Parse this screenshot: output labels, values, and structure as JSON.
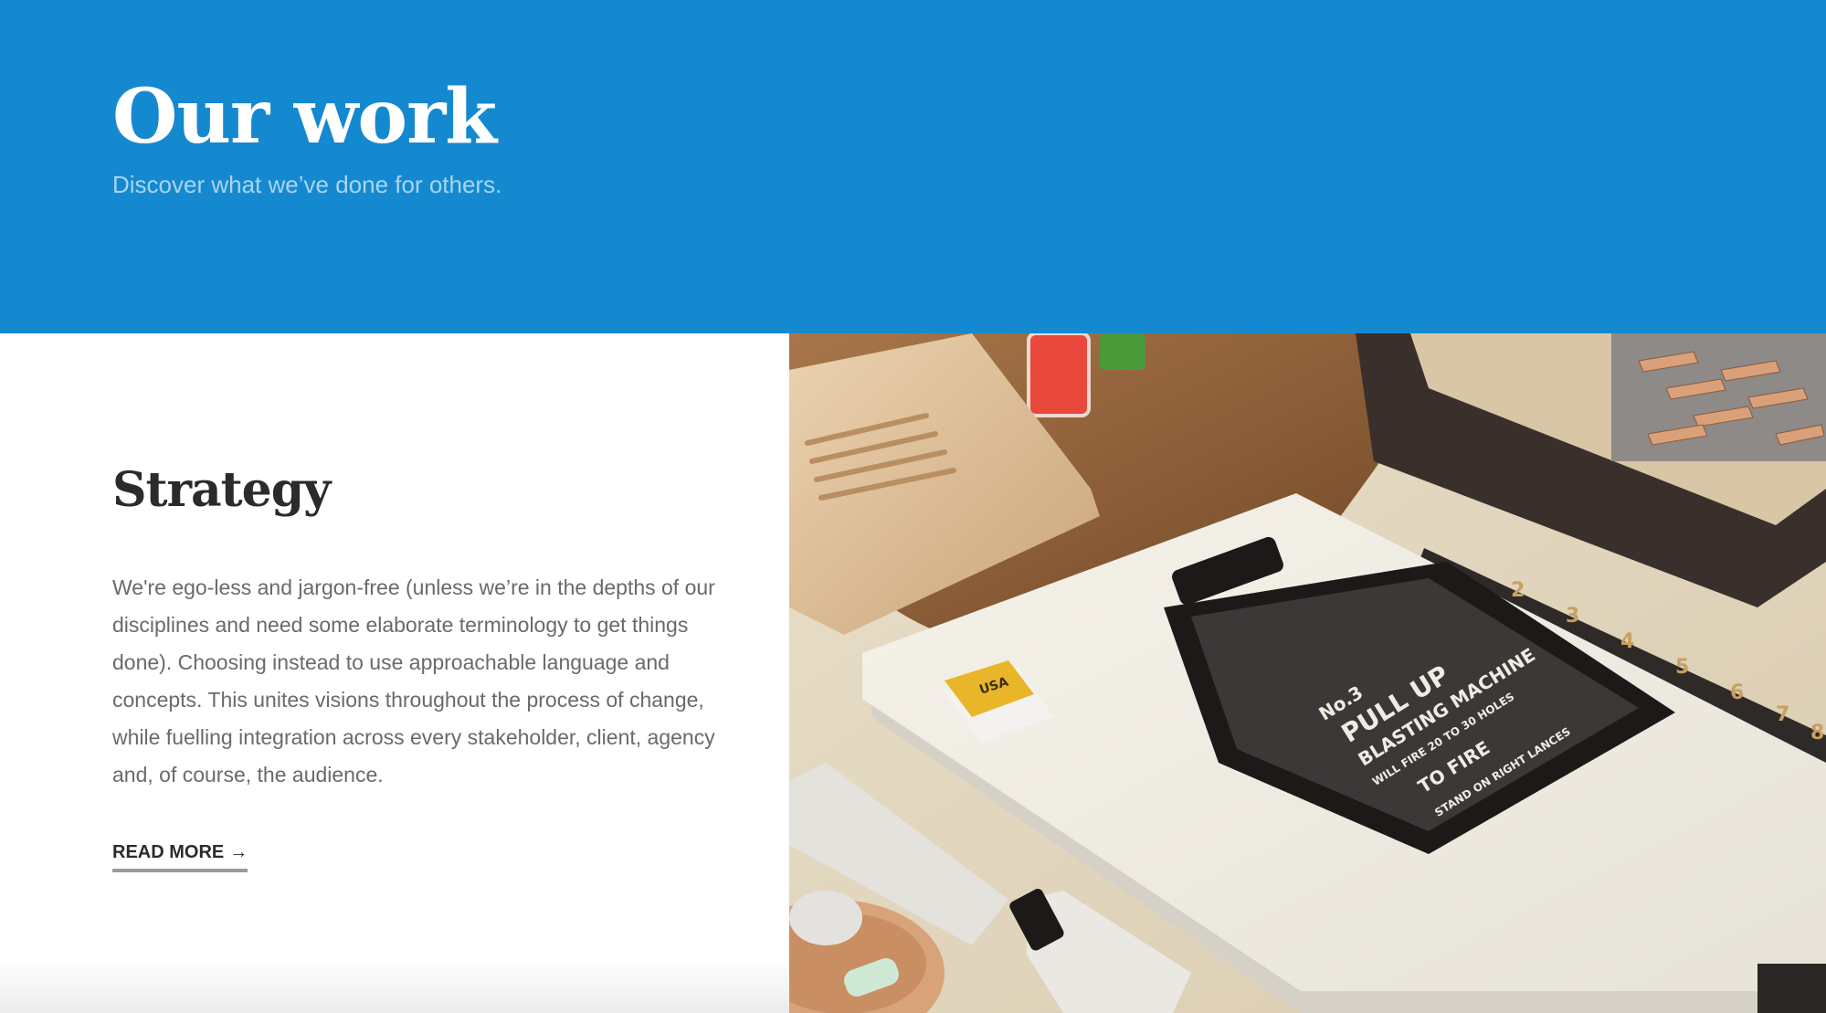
{
  "hero": {
    "title": "Our work",
    "subtitle": "Discover what we’ve done for others."
  },
  "section": {
    "heading": "Strategy",
    "body": "We're ego-less and jargon-free (unless we’re in the depths of our disciplines and need some elaborate terminology to get things done). Choosing instead to use approachable language and concepts. This unites visions throughout the process of change, while fuelling integration across every stakeholder, client, agency and, of course, the audience.",
    "read_more_label": "READ MORE",
    "read_more_arrow": "→"
  },
  "photo": {
    "eraser_text": "USA",
    "print_line_1": "No.3",
    "print_line_2": "PULL UP",
    "print_line_3": "BLASTING MACHINE",
    "print_line_4": "WILL FIRE 20 TO 30 HOLES",
    "print_line_5": "TO FIRE",
    "print_line_6": "STAND ON RIGHT LANCES",
    "ruler_numbers": [
      "2",
      "3",
      "4",
      "5",
      "6",
      "7",
      "8"
    ]
  },
  "colors": {
    "hero_background": "#1589d0",
    "hero_title": "#ffffff",
    "hero_subtitle": "#a9d4f1",
    "heading": "#2b2b2b",
    "body_text": "#6a6a6a"
  }
}
